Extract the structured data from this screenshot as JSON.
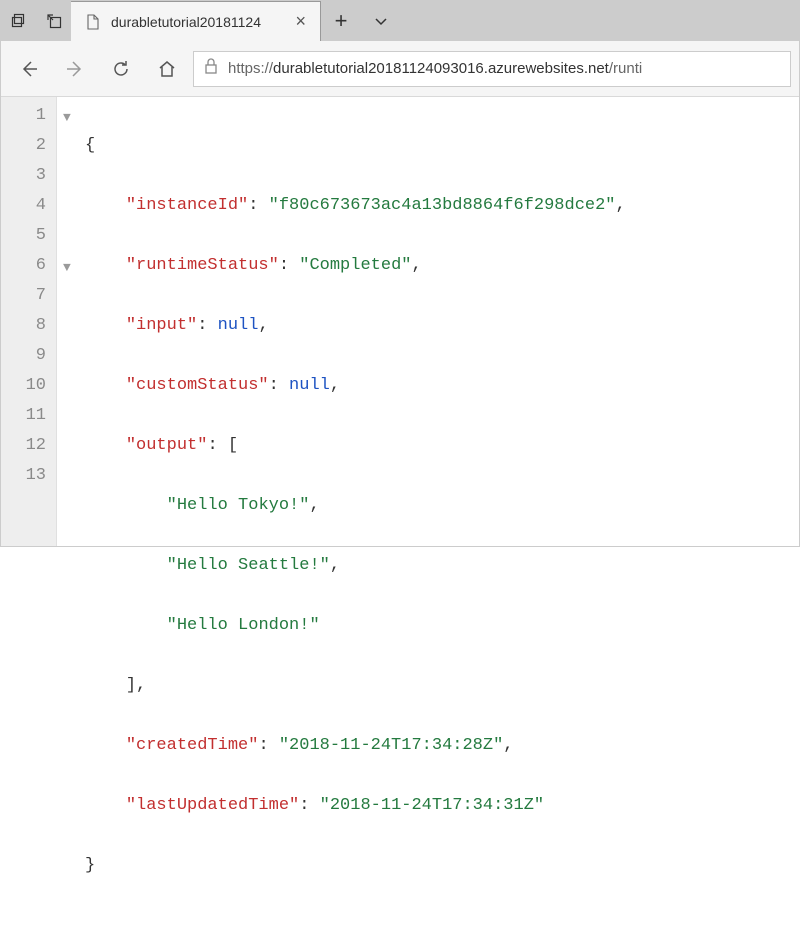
{
  "titlebar": {
    "tab_title": "durabletutorial20181124",
    "dup_icon": "⧉",
    "share_icon": "⇱"
  },
  "address": {
    "scheme": "https://",
    "host": "durabletutorial20181124093016.azurewebsites.net",
    "path": "/runti"
  },
  "lines": [
    "1",
    "2",
    "3",
    "4",
    "5",
    "6",
    "7",
    "8",
    "9",
    "10",
    "11",
    "12",
    "13"
  ],
  "json": {
    "instanceId_key": "\"instanceId\"",
    "instanceId_val": "\"f80c673673ac4a13bd8864f6f298dce2\"",
    "runtimeStatus_key": "\"runtimeStatus\"",
    "runtimeStatus_val": "\"Completed\"",
    "input_key": "\"input\"",
    "input_val": "null",
    "customStatus_key": "\"customStatus\"",
    "customStatus_val": "null",
    "output_key": "\"output\"",
    "output_v0": "\"Hello Tokyo!\"",
    "output_v1": "\"Hello Seattle!\"",
    "output_v2": "\"Hello London!\"",
    "createdTime_key": "\"createdTime\"",
    "createdTime_val": "\"2018-11-24T17:34:28Z\"",
    "lastUpdatedTime_key": "\"lastUpdatedTime\"",
    "lastUpdatedTime_val": "\"2018-11-24T17:34:31Z\""
  }
}
